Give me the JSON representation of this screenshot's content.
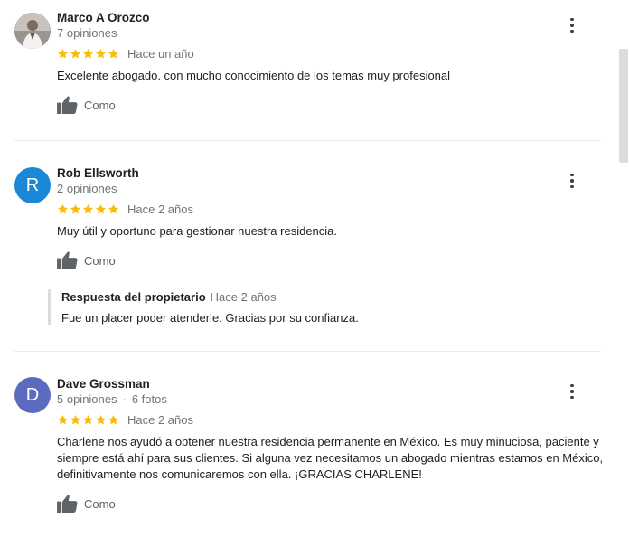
{
  "colors": {
    "star": "#fbbc04",
    "avatar_rob": "#1a88d7",
    "avatar_dave": "#5c6bc0"
  },
  "reviews": [
    {
      "author": "Marco A Orozco",
      "avatar_type": "photo",
      "avatar_initial": "",
      "count": "7 opiniones",
      "photos": "",
      "rating": 5,
      "when": "Hace un año",
      "text": "Excelente abogado. con mucho conocimiento de los temas muy profesional",
      "like_label": "Como"
    },
    {
      "author": "Rob Ellsworth",
      "avatar_type": "initial",
      "avatar_initial": "R",
      "count": "2 opiniones",
      "photos": "",
      "rating": 5,
      "when": "Hace 2 años",
      "text": "Muy útil y oportuno para gestionar nuestra residencia.",
      "like_label": "Como",
      "reply": {
        "owner": "Respuesta del propietario",
        "when": "Hace 2 años",
        "text": "Fue un placer poder atenderle. Gracias por su confianza."
      }
    },
    {
      "author": "Dave Grossman",
      "avatar_type": "initial",
      "avatar_initial": "D",
      "count": "5 opiniones",
      "photos": "6 fotos",
      "rating": 5,
      "when": "Hace 2 años",
      "text": "Charlene nos ayudó a obtener nuestra residencia permanente en México. Es muy minuciosa, paciente y siempre está ahí para sus clientes. Si alguna vez necesitamos un abogado mientras estamos en México, definitivamente nos comunicaremos con ella. ¡GRACIAS CHARLENE!",
      "like_label": "Como"
    }
  ]
}
